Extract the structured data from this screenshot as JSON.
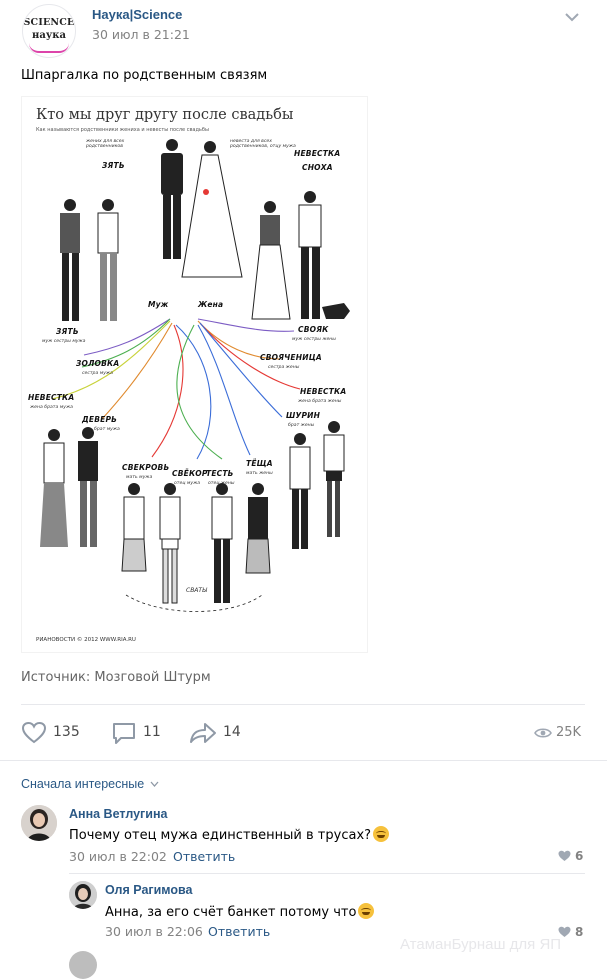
{
  "post": {
    "group": {
      "name": "Наука|Science",
      "avatar": {
        "line1": "SCIENCE",
        "line2": "наука"
      }
    },
    "date": "30 июл в 21:21",
    "text": "Шпаргалка по родственным связям",
    "image": {
      "title": "Кто мы друг другу после свадьбы",
      "subtitle": "Как называются родственники жениха и невесты после свадьбы",
      "labels": {
        "muzh": "Муж",
        "zhena": "Жена",
        "zyat_top": "ЗЯТЬ",
        "zyat_top_note": "жених для всех родственников",
        "nevestka_top": "НЕВЕСТКА",
        "snokha": "СНОХА",
        "nevestka_top_note": "невеста для всех родственников, отцу мужа",
        "zyat": "ЗЯТЬ",
        "zyat_note": "муж сестры мужа",
        "zolovka": "ЗОЛОВКА",
        "zolovka_note": "сестра мужа",
        "nevestka_left": "НЕВЕСТКА",
        "nevestka_left_note": "жена брата мужа",
        "dever": "ДЕВЕРЬ",
        "dever_note": "брат мужа",
        "svoyak": "СВОЯК",
        "svoyak_note": "муж сестры жены",
        "svoyachenitsa": "СВОЯЧЕНИЦА",
        "svoyachenitsa_note": "сестра жены",
        "nevestka_right": "НЕВЕСТКА",
        "nevestka_right_note": "жена брата жены",
        "shurin": "ШУРИН",
        "shurin_note": "брат жены",
        "svekrov": "СВЕКРОВЬ",
        "svekrov_note": "мать мужа",
        "svekor": "СВЁКОР",
        "svekor_note": "отец мужа",
        "test": "ТЕСТЬ",
        "test_note": "отец жены",
        "tescha": "ТЁЩА",
        "tescha_note": "мать жены",
        "svaty": "СВАТЫ"
      },
      "credit": "РИАНОВОСТИ © 2012 WWW.RIA.RU"
    },
    "source": "Источник: Мозговой Штурм",
    "actions": {
      "likes": "135",
      "comments": "11",
      "shares": "14",
      "views": "25K"
    }
  },
  "comments": {
    "sort_label": "Сначала интересные",
    "items": [
      {
        "author": "Анна Ветлугина",
        "text": "Почему отец мужа единственный в трусах?",
        "date": "30 июл в 22:02",
        "reply": "Ответить",
        "likes": "6"
      },
      {
        "author": "Оля Рагимова",
        "text": "Анна, за его счёт банкет потому что",
        "date": "30 июл в 22:06",
        "reply": "Ответить",
        "likes": "8"
      }
    ]
  },
  "watermark": "АтаманБурнаш для ЯП",
  "colors": {
    "link": "#2a5885",
    "muted": "#828282",
    "divider": "#e7e8ec"
  }
}
